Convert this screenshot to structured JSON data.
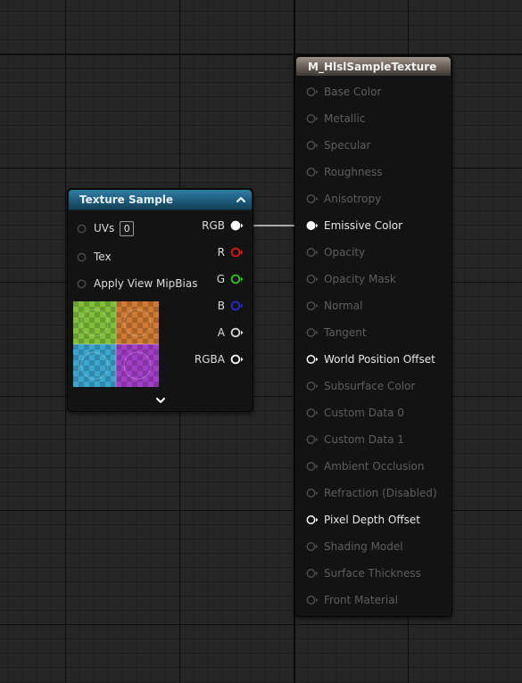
{
  "texture_node": {
    "title": "Texture Sample",
    "inputs": [
      {
        "label": "UVs",
        "value": "0"
      },
      {
        "label": "Tex"
      },
      {
        "label": "Apply View MipBias"
      }
    ],
    "outputs": [
      {
        "label": "RGB",
        "color": "#ffffff",
        "connected": true
      },
      {
        "label": "R",
        "color": "#e01717",
        "connected": false
      },
      {
        "label": "G",
        "color": "#1fce1f",
        "connected": false
      },
      {
        "label": "B",
        "color": "#2a2ad8",
        "connected": false
      },
      {
        "label": "A",
        "color": "#d8d8d8",
        "connected": false
      },
      {
        "label": "RGBA",
        "color": "#ffffff",
        "connected": false
      }
    ],
    "header_color": "#1c5a7a",
    "icons": {
      "collapse": "chevron-up-icon",
      "expand": "chevron-down-icon"
    }
  },
  "material_node": {
    "title": "M_HlslSampleTexture",
    "header_color": "#7a716a",
    "inputs": [
      {
        "label": "Base Color",
        "active": false
      },
      {
        "label": "Metallic",
        "active": false
      },
      {
        "label": "Specular",
        "active": false
      },
      {
        "label": "Roughness",
        "active": false
      },
      {
        "label": "Anisotropy",
        "active": false
      },
      {
        "label": "Emissive Color",
        "active": true,
        "connected": true
      },
      {
        "label": "Opacity",
        "active": false
      },
      {
        "label": "Opacity Mask",
        "active": false
      },
      {
        "label": "Normal",
        "active": false
      },
      {
        "label": "Tangent",
        "active": false
      },
      {
        "label": "World Position Offset",
        "active": true
      },
      {
        "label": "Subsurface Color",
        "active": false
      },
      {
        "label": "Custom Data 0",
        "active": false
      },
      {
        "label": "Custom Data 1",
        "active": false
      },
      {
        "label": "Ambient Occlusion",
        "active": false
      },
      {
        "label": "Refraction (Disabled)",
        "active": false
      },
      {
        "label": "Pixel Depth Offset",
        "active": true
      },
      {
        "label": "Shading Model",
        "active": false
      },
      {
        "label": "Surface Thickness",
        "active": false
      },
      {
        "label": "Front Material",
        "active": false
      }
    ]
  },
  "wire_color": "#d9d9d9"
}
